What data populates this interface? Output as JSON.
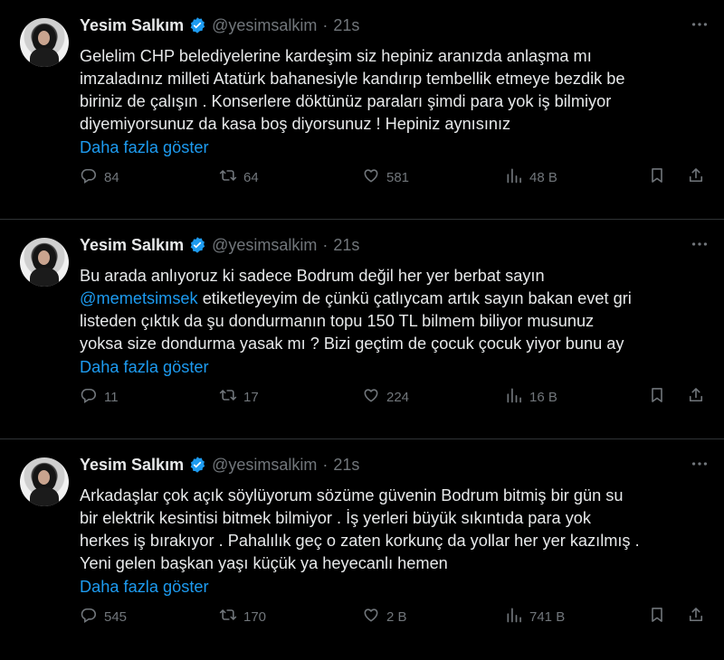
{
  "tweets": [
    {
      "name": "Yesim Salkım",
      "handle": "@yesimsalkim",
      "separator": "·",
      "time": "21s",
      "text_before": "Gelelim CHP belediyelerine kardeşim siz hepiniz aranızda anlaşma mı\nimzaladınız milleti Atatürk bahanesiyle kandırıp tembellik etmeye bezdik be\nbiriniz de çalışın . Konserlere döktünüz paraları şimdi para yok iş bilmiyor\ndiyemiyorsunuz da kasa boş diyorsunuz ! Hepiniz aynısınız",
      "mention": "",
      "text_after": "",
      "show_more": "Daha fazla göster",
      "replies": "84",
      "retweets": "64",
      "likes": "581",
      "views": "48 B"
    },
    {
      "name": "Yesim Salkım",
      "handle": "@yesimsalkim",
      "separator": "·",
      "time": "21s",
      "text_before": "Bu arada anlıyoruz ki sadece Bodrum değil her yer berbat sayın\n",
      "mention": "@memetsimsek",
      "text_after": " etiketleyeyim de çünkü çatlıycam artık sayın bakan evet gri\nlisteden çıktık da şu dondurmanın topu 150 TL bilmem biliyor musunuz\nyoksa size dondurma yasak mı ? Bizi geçtim de çocuk çocuk yiyor bunu ay",
      "show_more": "Daha fazla göster",
      "replies": "11",
      "retweets": "17",
      "likes": "224",
      "views": "16 B"
    },
    {
      "name": "Yesim Salkım",
      "handle": "@yesimsalkim",
      "separator": "·",
      "time": "21s",
      "text_before": "Arkadaşlar çok açık söylüyorum sözüme güvenin Bodrum bitmiş bir gün su\nbir elektrik kesintisi bitmek bilmiyor . İş yerleri büyük sıkıntıda para yok\nherkes iş bırakıyor . Pahalılık geç o zaten korkunç da yollar her yer kazılmış .\nYeni gelen başkan yaşı küçük ya heyecanlı hemen",
      "mention": "",
      "text_after": "",
      "show_more": "Daha fazla göster",
      "replies": "545",
      "retweets": "170",
      "likes": "2 B",
      "views": "741 B"
    }
  ],
  "colors": {
    "background": "#000000",
    "text": "#e7e9ea",
    "muted": "#71767b",
    "link": "#1d9bf0",
    "verified": "#1d9bf0",
    "divider": "#2f3336"
  },
  "icons": [
    "avatar",
    "verified-badge-icon",
    "more-options-icon",
    "reply-icon",
    "retweet-icon",
    "like-icon",
    "views-icon",
    "bookmark-icon",
    "share-icon"
  ]
}
